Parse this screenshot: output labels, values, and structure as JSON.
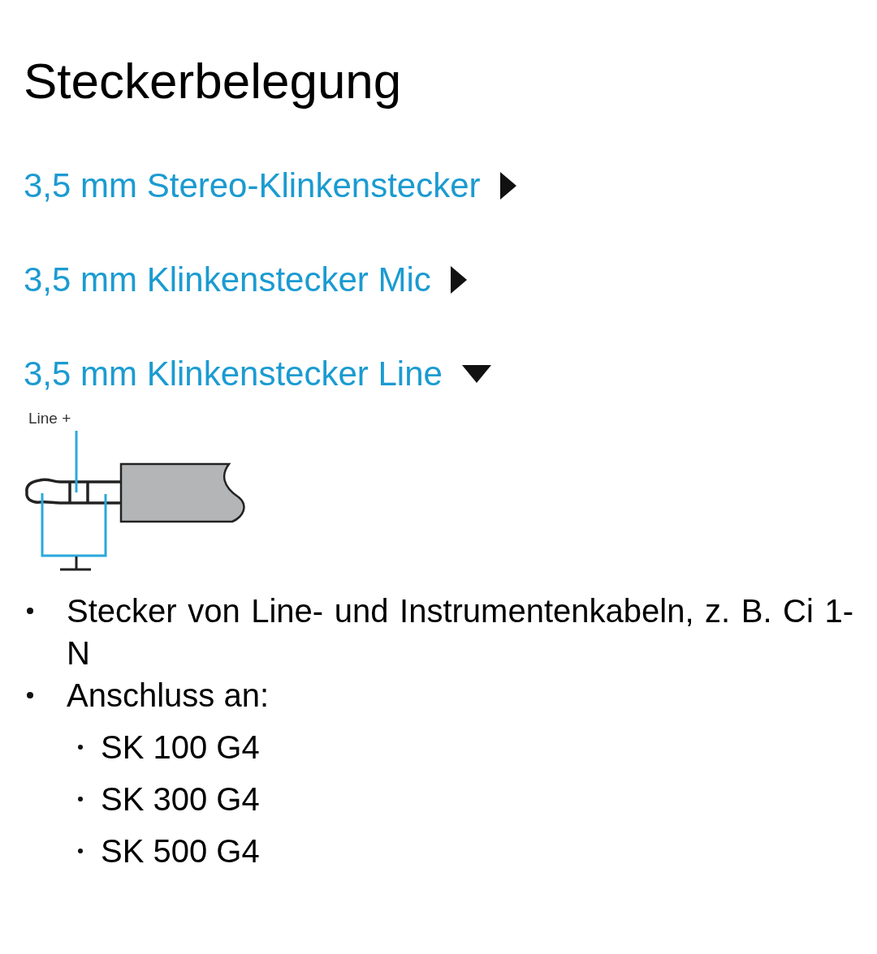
{
  "title": "Steckerbelegung",
  "sections": [
    {
      "label": "3,5 mm Stereo-Klinkenstecker",
      "expanded": false
    },
    {
      "label": "3,5 mm Klinkenstecker Mic",
      "expanded": false
    },
    {
      "label": "3,5 mm Klinkenstecker Line",
      "expanded": true,
      "diagram_label": "Line +",
      "bullets": [
        {
          "text": "Stecker von Line- und Instrumentenkabeln, z. B. Ci 1-N"
        },
        {
          "text": "Anschluss an:",
          "children": [
            {
              "text": "SK 100 G4"
            },
            {
              "text": "SK 300 G4"
            },
            {
              "text": "SK 500 G4"
            }
          ]
        }
      ]
    }
  ]
}
